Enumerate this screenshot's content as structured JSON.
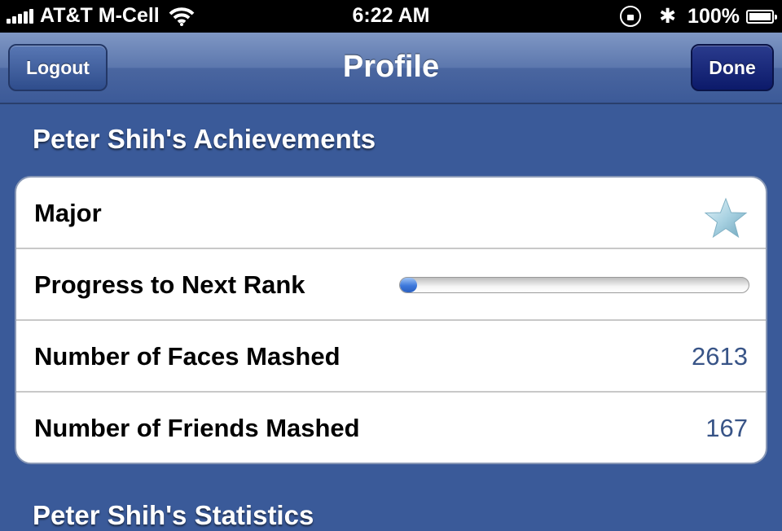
{
  "status_bar": {
    "carrier": "AT&T M-Cell",
    "time": "6:22 AM",
    "battery": "100%",
    "icons": [
      "signal-icon",
      "wifi-icon",
      "rotation-lock-icon",
      "bluetooth-icon",
      "battery-icon"
    ]
  },
  "nav": {
    "title": "Profile",
    "left_button": "Logout",
    "right_button": "Done"
  },
  "achievements": {
    "header": "Peter Shih's Achievements",
    "rank_label": "Major",
    "rank_icon": "star-icon",
    "progress_label": "Progress to Next Rank",
    "progress_fraction": 0.05,
    "faces_label": "Number of Faces Mashed",
    "faces_value": "2613",
    "friends_label": "Number of Friends Mashed",
    "friends_value": "167"
  },
  "statistics": {
    "header": "Peter Shih's Statistics"
  },
  "colors": {
    "background": "#3a5a99",
    "value_text": "#385487",
    "progress": "#3d78db"
  }
}
